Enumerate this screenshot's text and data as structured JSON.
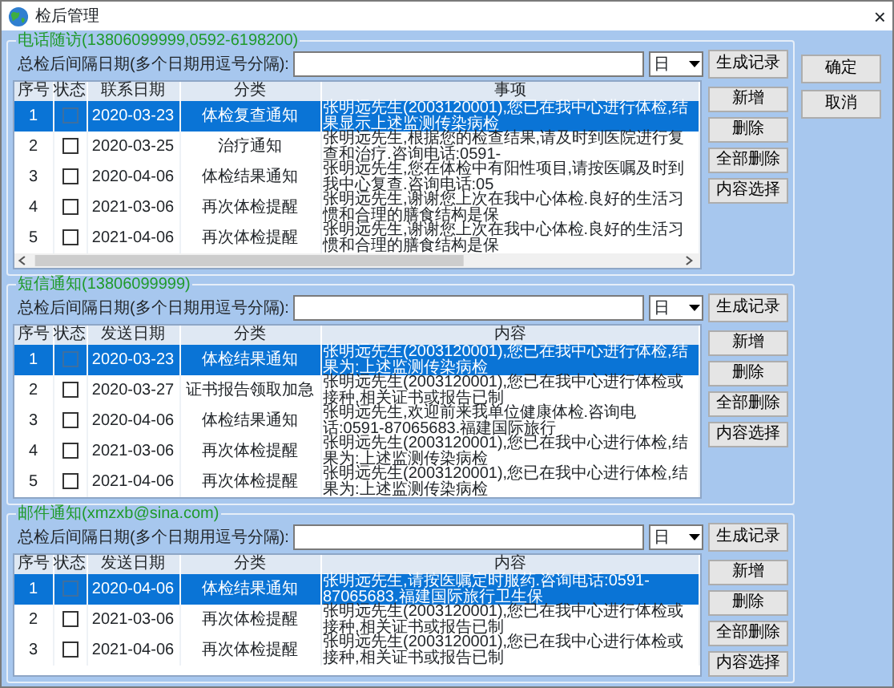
{
  "window": {
    "title": "检后管理",
    "close_glyph": "×"
  },
  "dialog_buttons": [
    "确定",
    "取消"
  ],
  "sections": [
    {
      "legend": "电话随访(13806099999,0592-6198200)",
      "interval_label": "总检后间隔日期(多个日期用逗号分隔):",
      "interval_unit": "日",
      "generate_button": "生成记录",
      "columns": [
        "序号",
        "状态",
        "联系日期",
        "分类",
        "事项"
      ],
      "horizontal_scrollbar": true,
      "rows": [
        {
          "index": "1",
          "checked": false,
          "selected": true,
          "date": "2020-03-23",
          "category": "体检复查通知",
          "content": "张明远先生(2003120001),您已在我中心进行体检,结果显示上述监测传染病检"
        },
        {
          "index": "2",
          "checked": false,
          "selected": false,
          "date": "2020-03-25",
          "category": "治疗通知",
          "content": "张明远先生,根据您的检查结果,请及时到医院进行复查和治疗.咨询电话:0591-"
        },
        {
          "index": "3",
          "checked": false,
          "selected": false,
          "date": "2020-04-06",
          "category": "体检结果通知",
          "content": "张明远先生,您在体检中有阳性项目,请按医嘱及时到我中心复查.咨询电话:05"
        },
        {
          "index": "4",
          "checked": false,
          "selected": false,
          "date": "2021-03-06",
          "category": "再次体检提醒",
          "content": "张明远先生,谢谢您上次在我中心体检.良好的生活习惯和合理的膳食结构是保"
        },
        {
          "index": "5",
          "checked": false,
          "selected": false,
          "date": "2021-04-06",
          "category": "再次体检提醒",
          "content": "张明远先生,谢谢您上次在我中心体检.良好的生活习惯和合理的膳食结构是保"
        }
      ],
      "side_buttons": [
        "新增",
        "删除",
        "全部删除",
        "内容选择"
      ]
    },
    {
      "legend": "短信通知(13806099999)",
      "interval_label": "总检后间隔日期(多个日期用逗号分隔):",
      "interval_unit": "日",
      "generate_button": "生成记录",
      "columns": [
        "序号",
        "状态",
        "发送日期",
        "分类",
        "内容"
      ],
      "horizontal_scrollbar": false,
      "rows": [
        {
          "index": "1",
          "checked": false,
          "selected": true,
          "date": "2020-03-23",
          "category": "体检结果通知",
          "content": "张明远先生(2003120001),您已在我中心进行体检,结果为:上述监测传染病检"
        },
        {
          "index": "2",
          "checked": false,
          "selected": false,
          "date": "2020-03-27",
          "category": "证书报告领取加急",
          "content": "张明远先生(2003120001),您已在我中心进行体检或接种,相关证书或报告已制"
        },
        {
          "index": "3",
          "checked": false,
          "selected": false,
          "date": "2020-04-06",
          "category": "体检结果通知",
          "content": "张明远先生,欢迎前来我单位健康体检.咨询电话:0591-87065683.福建国际旅行"
        },
        {
          "index": "4",
          "checked": false,
          "selected": false,
          "date": "2021-03-06",
          "category": "再次体检提醒",
          "content": "张明远先生(2003120001),您已在我中心进行体检,结果为:上述监测传染病检"
        },
        {
          "index": "5",
          "checked": false,
          "selected": false,
          "date": "2021-04-06",
          "category": "再次体检提醒",
          "content": "张明远先生(2003120001),您已在我中心进行体检,结果为:上述监测传染病检"
        }
      ],
      "side_buttons": [
        "新增",
        "删除",
        "全部删除",
        "内容选择"
      ]
    },
    {
      "legend": "邮件通知(xmzxb@sina.com)",
      "interval_label": "总检后间隔日期(多个日期用逗号分隔):",
      "interval_unit": "日",
      "generate_button": "生成记录",
      "columns": [
        "序号",
        "状态",
        "发送日期",
        "分类",
        "内容"
      ],
      "horizontal_scrollbar": false,
      "rows": [
        {
          "index": "1",
          "checked": false,
          "selected": true,
          "date": "2020-04-06",
          "category": "体检结果通知",
          "content": "张明远先生,请按医嘱定时服药.咨询电话:0591-87065683.福建国际旅行卫生保"
        },
        {
          "index": "2",
          "checked": false,
          "selected": false,
          "date": "2021-03-06",
          "category": "再次体检提醒",
          "content": "张明远先生(2003120001),您已在我中心进行体检或接种,相关证书或报告已制"
        },
        {
          "index": "3",
          "checked": false,
          "selected": false,
          "date": "2021-04-06",
          "category": "再次体检提醒",
          "content": "张明远先生(2003120001),您已在我中心进行体检或接种,相关证书或报告已制"
        }
      ],
      "side_buttons": [
        "新增",
        "删除",
        "全部删除",
        "内容选择"
      ]
    }
  ]
}
